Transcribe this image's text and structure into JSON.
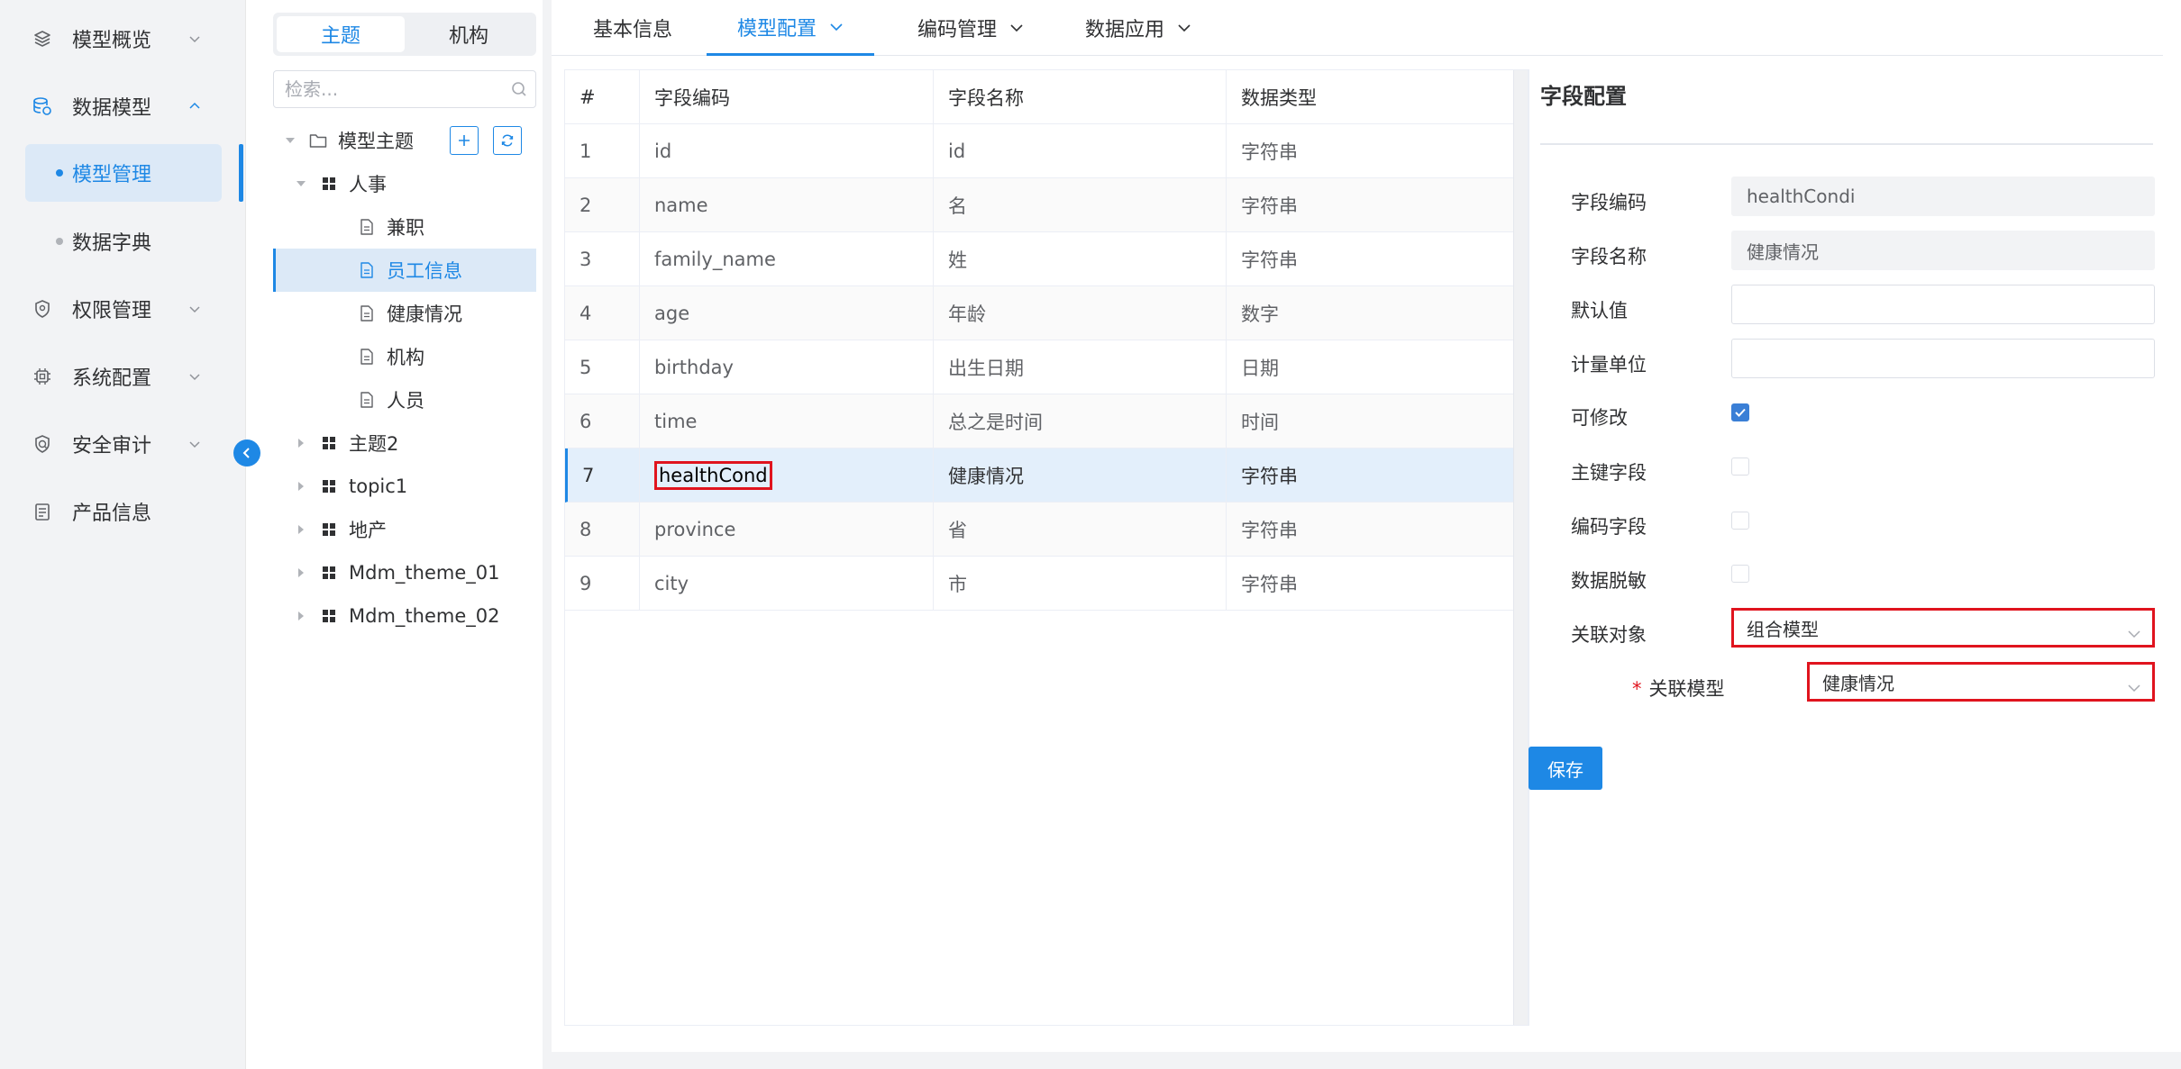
{
  "nav": {
    "items": [
      {
        "label": "模型概览",
        "icon": "layers-icon"
      },
      {
        "label": "数据模型",
        "icon": "database-icon"
      },
      {
        "label": "权限管理",
        "icon": "shield-icon"
      },
      {
        "label": "系统配置",
        "icon": "chip-icon"
      },
      {
        "label": "安全审计",
        "icon": "shield-check-icon"
      },
      {
        "label": "产品信息",
        "icon": "document-list-icon"
      }
    ],
    "sub_items": [
      {
        "label": "模型管理",
        "active": true
      },
      {
        "label": "数据字典",
        "active": false
      }
    ]
  },
  "tree": {
    "segments": [
      "主题",
      "机构"
    ],
    "search_placeholder": "检索...",
    "root_label": "模型主题",
    "nodes": [
      {
        "label": "人事"
      },
      {
        "label": "兼职"
      },
      {
        "label": "员工信息"
      },
      {
        "label": "健康情况"
      },
      {
        "label": "机构"
      },
      {
        "label": "人员"
      },
      {
        "label": "主题2"
      },
      {
        "label": "topic1"
      },
      {
        "label": "地产"
      },
      {
        "label": "Mdm_theme_01"
      },
      {
        "label": "Mdm_theme_02"
      }
    ]
  },
  "tabs": [
    "基本信息",
    "模型配置",
    "编码管理",
    "数据应用"
  ],
  "table": {
    "columns": [
      "#",
      "字段编码",
      "字段名称",
      "数据类型"
    ],
    "rows": [
      [
        "1",
        "id",
        "id",
        "字符串"
      ],
      [
        "2",
        "name",
        "名",
        "字符串"
      ],
      [
        "3",
        "family_name",
        "姓",
        "字符串"
      ],
      [
        "4",
        "age",
        "年龄",
        "数字"
      ],
      [
        "5",
        "birthday",
        "出生日期",
        "日期"
      ],
      [
        "6",
        "time",
        "总之是时间",
        "时间"
      ],
      [
        "7",
        "healthCond",
        "健康情况",
        "字符串"
      ],
      [
        "8",
        "province",
        "省",
        "字符串"
      ],
      [
        "9",
        "city",
        "市",
        "字符串"
      ]
    ]
  },
  "config": {
    "title": "字段配置",
    "labels": {
      "code": "字段编码",
      "name": "字段名称",
      "default": "默认值",
      "unit": "计量单位",
      "editable": "可修改",
      "pk": "主键字段",
      "encode": "编码字段",
      "mask": "数据脱敏",
      "relation_obj": "关联对象",
      "relation_model": "关联模型"
    },
    "values": {
      "code": "healthCondi",
      "name": "健康情况",
      "default": "",
      "unit": "",
      "editable": true,
      "pk": false,
      "encode": false,
      "mask": false,
      "relation_obj": "组合模型",
      "relation_model": "健康情况"
    },
    "required_mark": "*",
    "save_label": "保存"
  },
  "colors": {
    "accent": "#1e88e5",
    "highlight": "#e0141e",
    "selected_bg": "#dce9f7"
  }
}
